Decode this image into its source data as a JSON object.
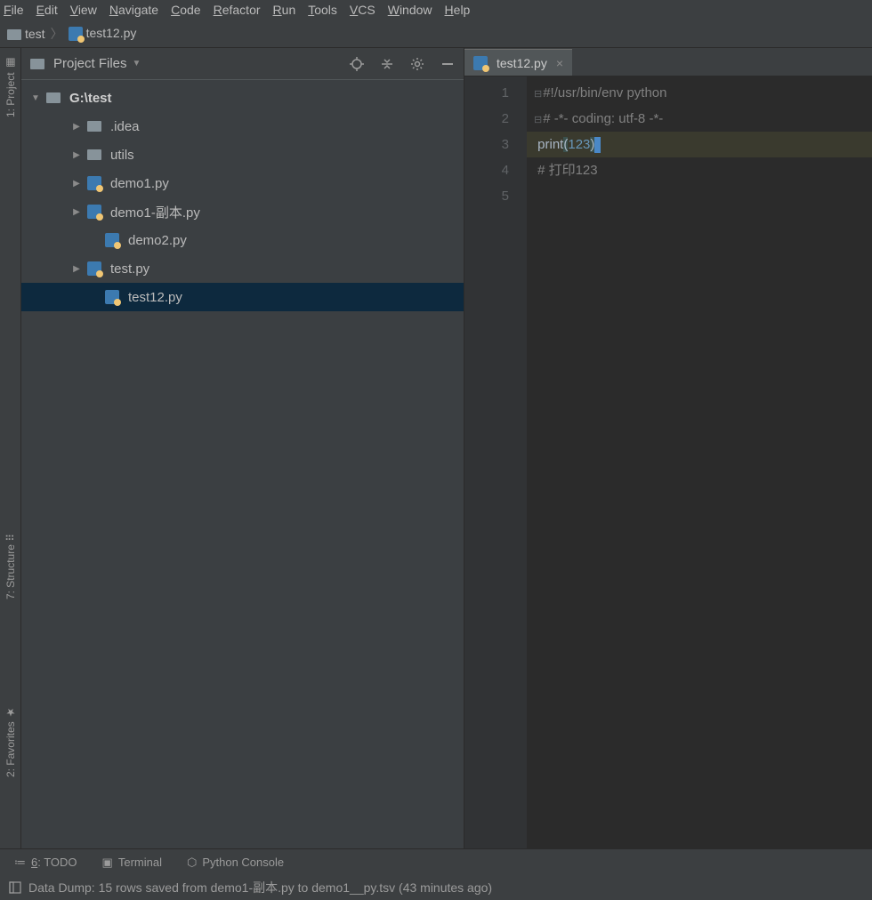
{
  "menu": [
    "File",
    "Edit",
    "View",
    "Navigate",
    "Code",
    "Refactor",
    "Run",
    "Tools",
    "VCS",
    "Window",
    "Help"
  ],
  "breadcrumb": {
    "root": "test",
    "file": "test12.py"
  },
  "sidebars": {
    "project": "1: Project",
    "structure": "7: Structure",
    "favorites": "2: Favorites"
  },
  "panel": {
    "title": "Project Files"
  },
  "tree": {
    "root": "G:\\test",
    "items": [
      {
        "label": ".idea",
        "type": "folder",
        "expand": true,
        "indent": 56
      },
      {
        "label": "utils",
        "type": "folder",
        "expand": true,
        "indent": 56
      },
      {
        "label": "demo1.py",
        "type": "py",
        "expand": true,
        "indent": 56
      },
      {
        "label": "demo1-副本.py",
        "type": "py",
        "expand": true,
        "indent": 56
      },
      {
        "label": "demo2.py",
        "type": "py",
        "expand": false,
        "indent": 76
      },
      {
        "label": "test.py",
        "type": "py",
        "expand": true,
        "indent": 56
      },
      {
        "label": "test12.py",
        "type": "py",
        "expand": false,
        "indent": 76,
        "selected": true
      }
    ]
  },
  "tab": {
    "label": "test12.py"
  },
  "code": {
    "lines": [
      {
        "n": "1",
        "type": "comment",
        "text": "#!/usr/bin/env python",
        "fold": true
      },
      {
        "n": "2",
        "type": "comment",
        "text": "# -*- coding: utf-8 -*-",
        "fold": true
      },
      {
        "n": "3",
        "type": "print",
        "fn": "print",
        "arg": "123",
        "hl": true
      },
      {
        "n": "4",
        "type": "comment",
        "text": "# 打印123"
      },
      {
        "n": "5",
        "type": "blank"
      }
    ]
  },
  "tools": {
    "todo": "6: TODO",
    "terminal": "Terminal",
    "console": "Python Console"
  },
  "status": "Data Dump: 15 rows saved from demo1-副本.py to demo1__py.tsv (43 minutes ago)"
}
